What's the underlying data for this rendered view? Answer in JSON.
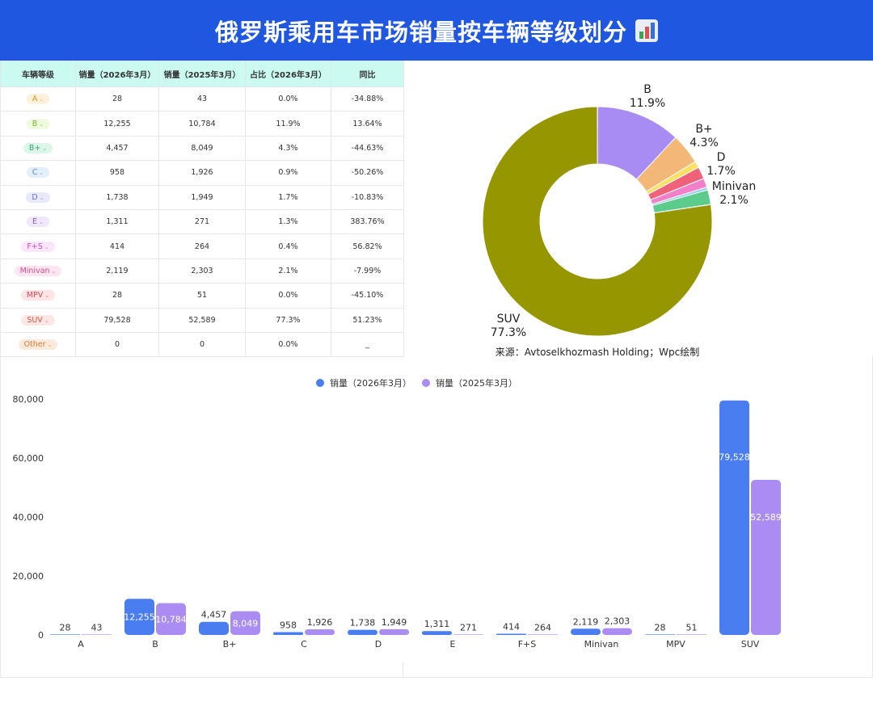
{
  "header": {
    "title": "俄罗斯乘用车市场销量按车辆等级划分"
  },
  "table": {
    "headers": [
      "车辆等级",
      "销量（2026年3月）",
      "销量（2025年3月）",
      "占比（2026年3月）",
      "同比"
    ],
    "rows": [
      {
        "class": "A",
        "s2026": "28",
        "s2025": "43",
        "share": "0.0%",
        "yoy": "-34.88%",
        "tag_bg": "#fdf1d9",
        "tag_fg": "#c99a2e"
      },
      {
        "class": "B",
        "s2026": "12,255",
        "s2025": "10,784",
        "share": "11.9%",
        "yoy": "13.64%",
        "tag_bg": "#eefbdc",
        "tag_fg": "#7cb83a"
      },
      {
        "class": "B+",
        "s2026": "4,457",
        "s2025": "8,049",
        "share": "4.3%",
        "yoy": "-44.63%",
        "tag_bg": "#dcf7ea",
        "tag_fg": "#2ea86b"
      },
      {
        "class": "C",
        "s2026": "958",
        "s2025": "1,926",
        "share": "0.9%",
        "yoy": "-50.26%",
        "tag_bg": "#e3effd",
        "tag_fg": "#5a8ad6"
      },
      {
        "class": "D",
        "s2026": "1,738",
        "s2025": "1,949",
        "share": "1.7%",
        "yoy": "-10.83%",
        "tag_bg": "#e8e9fd",
        "tag_fg": "#6b6fd6"
      },
      {
        "class": "E",
        "s2026": "1,311",
        "s2025": "271",
        "share": "1.3%",
        "yoy": "383.76%",
        "tag_bg": "#f0e8fd",
        "tag_fg": "#8a5ad6"
      },
      {
        "class": "F+S",
        "s2026": "414",
        "s2025": "264",
        "share": "0.4%",
        "yoy": "56.82%",
        "tag_bg": "#fbe6fb",
        "tag_fg": "#c04fc0"
      },
      {
        "class": "Minivan",
        "s2026": "2,119",
        "s2025": "2,303",
        "share": "2.1%",
        "yoy": "-7.99%",
        "tag_bg": "#fde6f1",
        "tag_fg": "#d04f8a"
      },
      {
        "class": "MPV",
        "s2026": "28",
        "s2025": "51",
        "share": "0.0%",
        "yoy": "-45.10%",
        "tag_bg": "#fde4e6",
        "tag_fg": "#d44a55"
      },
      {
        "class": "SUV",
        "s2026": "79,528",
        "s2025": "52,589",
        "share": "77.3%",
        "yoy": "51.23%",
        "tag_bg": "#fde7e4",
        "tag_fg": "#d45a4a"
      },
      {
        "class": "Other",
        "s2026": "0",
        "s2025": "0",
        "share": "0.0%",
        "yoy": "_",
        "tag_bg": "#fdeadb",
        "tag_fg": "#d67a3a"
      }
    ]
  },
  "chart_data": [
    {
      "type": "pie",
      "donut": true,
      "categories": [
        "A",
        "B",
        "B+",
        "C",
        "D",
        "E",
        "F+S",
        "Minivan",
        "MPV",
        "SUV",
        "Other"
      ],
      "values": [
        28,
        12255,
        4457,
        958,
        1738,
        1311,
        414,
        2119,
        28,
        79528,
        0
      ],
      "colors": [
        "#6f8cf5",
        "#a98cf3",
        "#f3b877",
        "#fde064",
        "#f0627a",
        "#f180c8",
        "#8fd0f0",
        "#5ccc8c",
        "#c4c4c4",
        "#969600",
        "#cccccc"
      ],
      "slice_labels": [
        {
          "name": "B",
          "pct": "11.9%"
        },
        {
          "name": "B+",
          "pct": "4.3%"
        },
        {
          "name": "D",
          "pct": "1.7%"
        },
        {
          "name": "Minivan",
          "pct": "2.1%"
        },
        {
          "name": "SUV",
          "pct": "77.3%"
        }
      ],
      "source": "来源：Avtoselkhozmash Holding；Wpc绘制"
    },
    {
      "type": "bar",
      "categories": [
        "A",
        "B",
        "B+",
        "C",
        "D",
        "E",
        "F+S",
        "Minivan",
        "MPV",
        "SUV"
      ],
      "series": [
        {
          "name": "销量（2026年3月）",
          "values": [
            28,
            12255,
            4457,
            958,
            1738,
            1311,
            414,
            2119,
            28,
            79528
          ],
          "labels": [
            "28",
            "12,255",
            "4,457",
            "958",
            "1,738",
            "1,311",
            "414",
            "2,119",
            "28",
            "79,528"
          ],
          "color": "#4a7ef0"
        },
        {
          "name": "销量（2025年3月）",
          "values": [
            43,
            10784,
            8049,
            1926,
            1949,
            271,
            264,
            2303,
            51,
            52589
          ],
          "labels": [
            "43",
            "10,784",
            "8,049",
            "1,926",
            "1,949",
            "271",
            "264",
            "2,303",
            "51",
            "52,589"
          ],
          "color": "#ab8cf3"
        }
      ],
      "yticks": [
        "0",
        "20,000",
        "40,000",
        "60,000",
        "80,000"
      ],
      "ylim": [
        0,
        80000
      ],
      "legend": "top-center",
      "grid": false
    }
  ]
}
